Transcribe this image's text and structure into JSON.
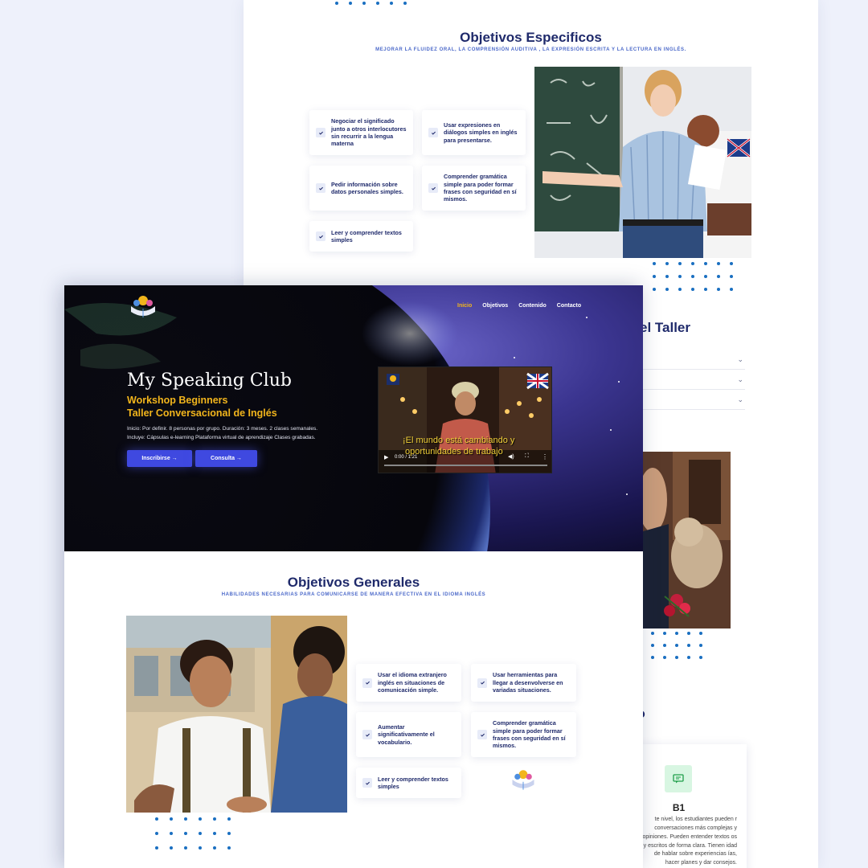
{
  "objetivos_especificos": {
    "title": "Objetivos Especificos",
    "subtitle": "MEJORAR LA FLUIDEZ ORAL, LA COMPRENSIÓN AUDITIVA , LA EXPRESIÓN ESCRITA Y LA LECTURA EN INGLÉS.",
    "items": [
      "Negociar el significado junto a otros interlocutores sin recurrir a la lengua materna",
      "Usar expresiones en diálogos simples en inglés para presentarse.",
      "Pedir información sobre datos personales simples.",
      "Comprender gramática simple para poder formar frases con seguridad en sí mismos.",
      "Leer y comprender textos simples"
    ]
  },
  "taller": {
    "title": "el Taller"
  },
  "niveles": {
    "title_fragment": "o",
    "card_name": "B1",
    "card_desc": "te nivel, los estudiantes pueden r conversaciones más complejas y opiniones. Pueden entender textos os y escritos de forma clara. Tienen idad de hablar sobre experiencias ías, hacer planes y dar consejos."
  },
  "nav": {
    "items": [
      "Inicio",
      "Objetivos",
      "Contenido",
      "Contacto"
    ],
    "active": "Inicio"
  },
  "hero": {
    "title": "My Speaking Club",
    "subtitle1": "Workshop Beginners",
    "subtitle2": "Taller Conversacional de Inglés",
    "p1": "Inicio: Por definir. 8 personas por grupo. Duración: 3 meses. 2 clases semanales.",
    "p2": "Incluye: Cápsulas e-learning Plataforma virtual de aprendizaje Clases grabadas.",
    "btn1": "Inscribirse →",
    "btn2": "Consulta →"
  },
  "video": {
    "subtitle_line1": "¡El mundo está cambiando y",
    "subtitle_line2": "oportunidades de trabajo",
    "time": "0:00 / 1:21"
  },
  "objetivos_generales": {
    "title": "Objetivos Generales",
    "subtitle": "HABILIDADES NECESARIAS PARA COMUNICARSE DE MANERA EFECTIVA EN EL IDIOMA INGLÉS",
    "items": [
      "Usar el idioma extranjero inglés en situaciones de comunicación simple.",
      "Usar herramientas para llegar a desenvolverse en variadas situaciones.",
      "Aumentar significativamente el vocabulario.",
      "Comprender gramática simple para poder formar frases con seguridad en sí mismos.",
      "Leer y comprender textos simples"
    ]
  },
  "logo_text": "My Speaking Club",
  "colors": {
    "accent": "#3f49e0",
    "gold": "#f2b51c",
    "navy": "#1f2a6b",
    "dots": "#1a6fc1"
  }
}
